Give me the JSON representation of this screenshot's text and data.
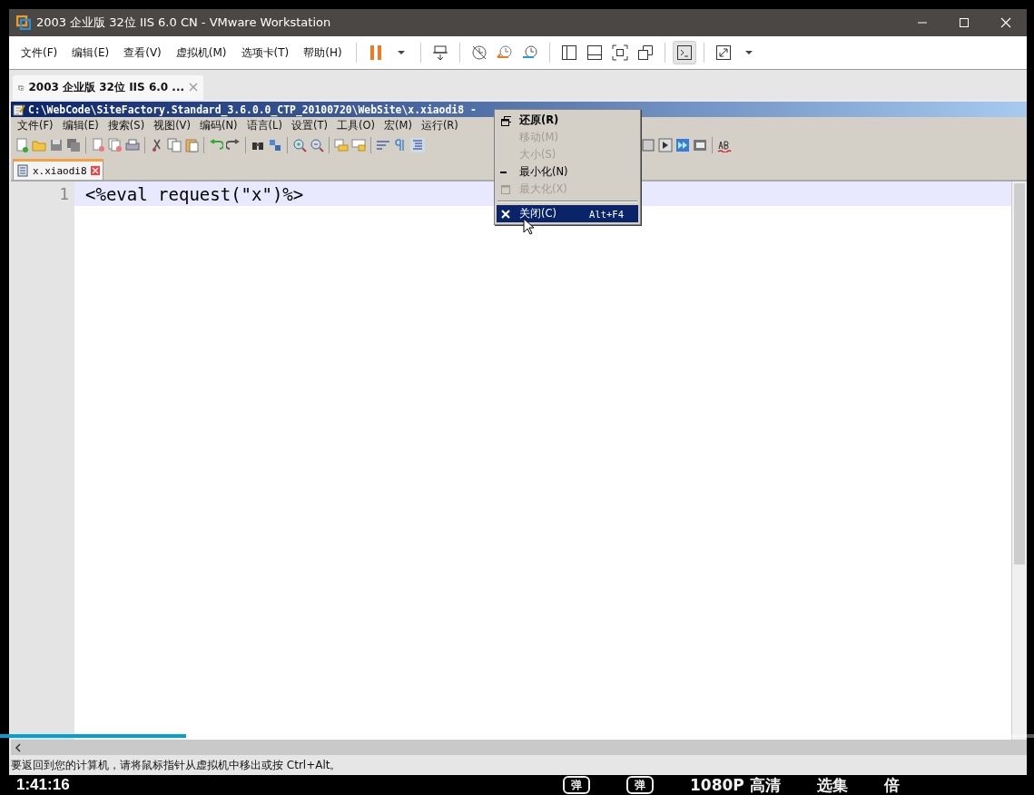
{
  "window": {
    "title": "2003 企业版 32位 IIS 6.0 CN  - VMware Workstation"
  },
  "menu": [
    "文件(F)",
    "编辑(E)",
    "查看(V)",
    "虚拟机(M)",
    "选项卡(T)",
    "帮助(H)"
  ],
  "toolbar": {
    "console_view": {
      "selected": true
    }
  },
  "tabs": [
    {
      "label": "2003 企业版 32位 IIS 6.0 ...",
      "selected": true
    }
  ],
  "guest": {
    "title": "C:\\WebCode\\SiteFactory.Standard_3.6.0.0_CTP_20100720\\WebSite\\x.xiaodi8 - ",
    "menu": [
      "文件(F)",
      "编辑(E)",
      "搜索(S)",
      "视图(V)",
      "编码(N)",
      "语言(L)",
      "设置(T)",
      "工具(O)",
      "宏(M)",
      "运行(R)"
    ],
    "file_tabs": [
      {
        "label": "x.xiaodi8",
        "selected": true
      }
    ],
    "lines": [
      {
        "number": "1",
        "text": "<%eval request(\"x\")%>",
        "current": true
      }
    ],
    "system_menu": [
      {
        "kind": "restore",
        "label": "还原(R)",
        "disabled": false,
        "selected": false
      },
      {
        "kind": "none",
        "label": "移动(M)",
        "disabled": true,
        "selected": false
      },
      {
        "kind": "none",
        "label": "大小(S)",
        "disabled": true,
        "selected": false
      },
      {
        "kind": "minimize",
        "label": "最小化(N)",
        "disabled": false,
        "selected": false
      },
      {
        "kind": "maximize",
        "label": "最大化(X)",
        "disabled": true,
        "selected": false
      },
      {
        "kind": "close",
        "label": "关闭(C)",
        "shortcut": "Alt+F4",
        "disabled": false,
        "selected": true
      }
    ]
  },
  "status_bar": "要返回到您的计算机，请将鼠标指针从虚拟机中移出或按 Ctrl+Alt。",
  "video": {
    "progress": {
      "level": 0.18
    },
    "time": "1:41:16",
    "controls": [
      {
        "kind": "danmaku",
        "label": "弹"
      },
      {
        "kind": "danmaku",
        "label": "弹"
      },
      {
        "kind": "text",
        "label": "1080P 高清"
      },
      {
        "kind": "text",
        "label": "选集"
      },
      {
        "kind": "text",
        "label": "倍"
      }
    ]
  }
}
